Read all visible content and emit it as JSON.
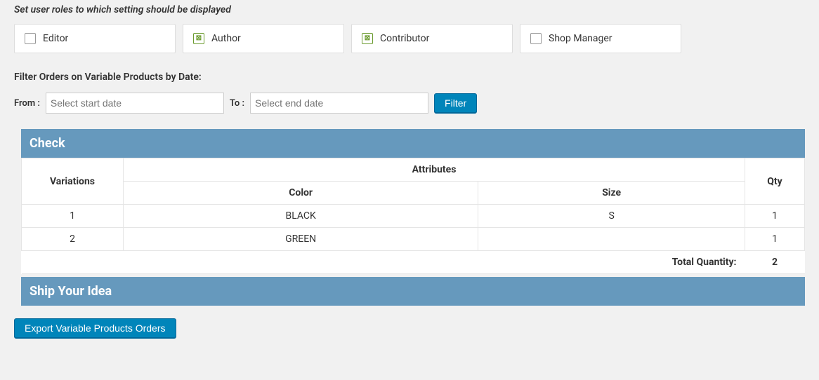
{
  "roles": {
    "description": "Set user roles to which setting should be displayed",
    "items": [
      {
        "label": "Editor",
        "checked": false
      },
      {
        "label": "Author",
        "checked": true
      },
      {
        "label": "Contributor",
        "checked": true
      },
      {
        "label": "Shop Manager",
        "checked": false
      }
    ]
  },
  "filter": {
    "title": "Filter Orders on Variable Products by Date:",
    "from_label": "From :",
    "to_label": "To :",
    "from_placeholder": "Select start date",
    "to_placeholder": "Select end date",
    "button": "Filter"
  },
  "table": {
    "product_header": "Check",
    "attributes_header": "Attributes",
    "columns": {
      "variations": "Variations",
      "color": "Color",
      "size": "Size",
      "qty": "Qty"
    },
    "rows": [
      {
        "variations": "1",
        "color": "BLACK",
        "size": "S",
        "qty": "1"
      },
      {
        "variations": "2",
        "color": "GREEN",
        "size": "",
        "qty": "1"
      }
    ],
    "total_label": "Total Quantity:",
    "total_value": "2",
    "second_header": "Ship Your Idea"
  },
  "export_button": "Export Variable Products Orders"
}
